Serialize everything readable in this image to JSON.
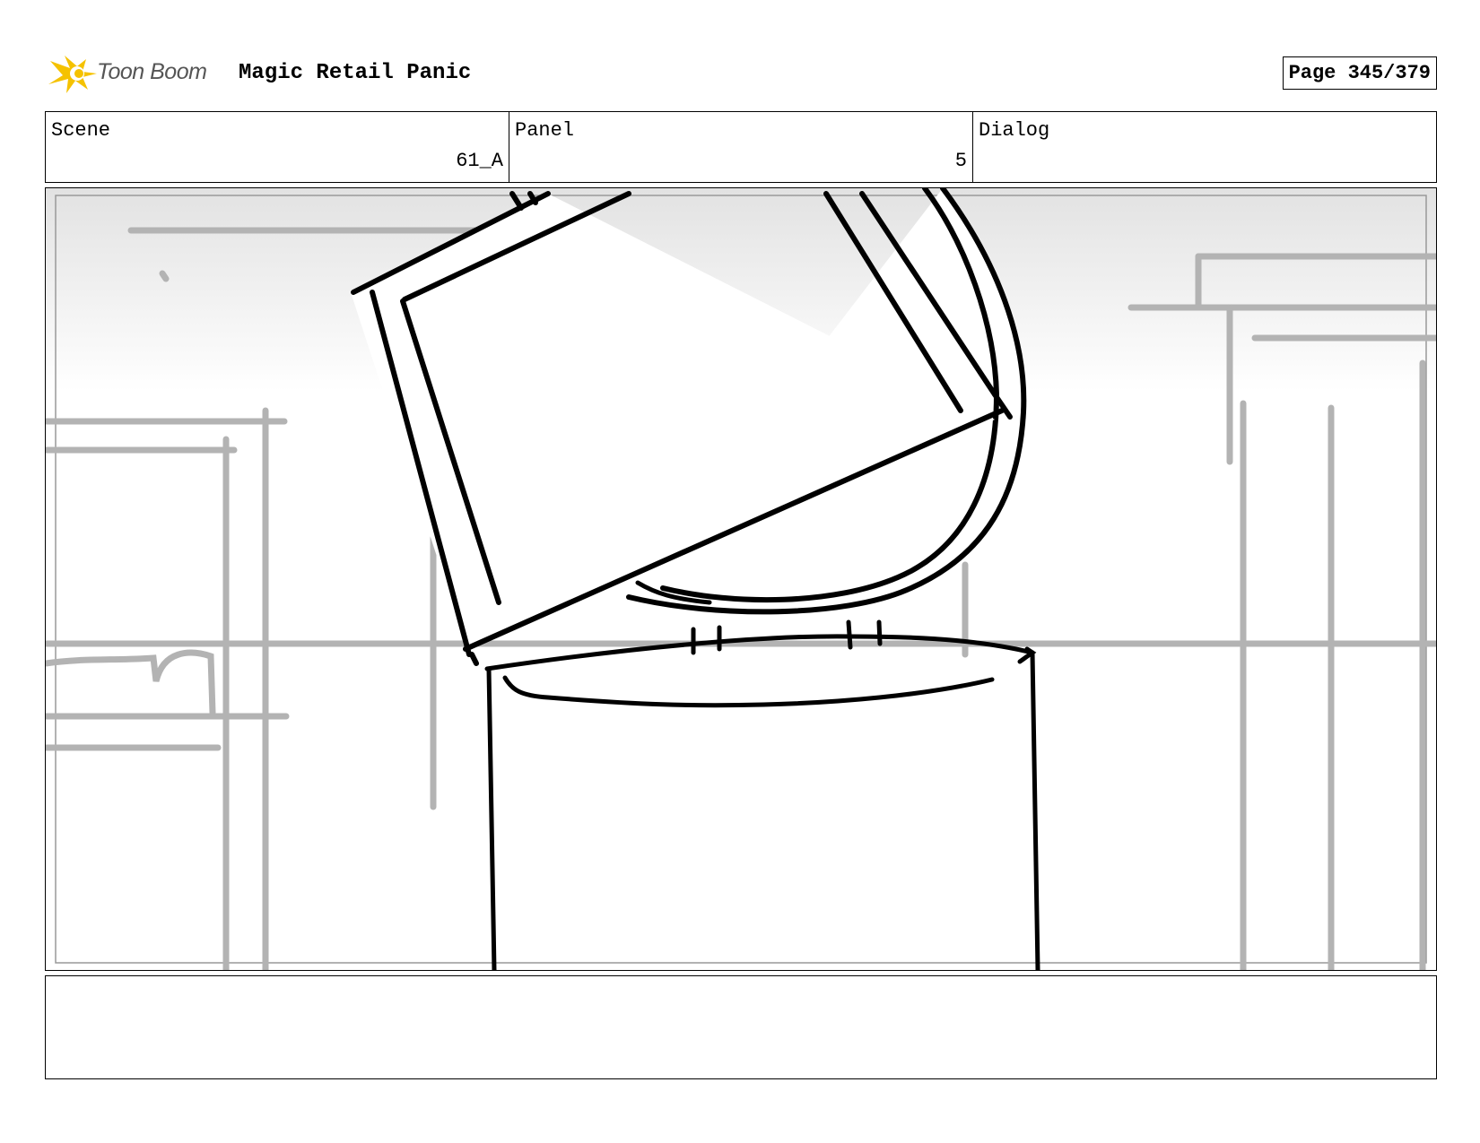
{
  "header": {
    "logo_text": "Toon Boom",
    "project_title": "Magic Retail Panic",
    "page_label": "Page 345/379"
  },
  "info": {
    "scene_label": "Scene",
    "scene_value": "61_A",
    "panel_label": "Panel",
    "panel_value": "5",
    "dialog_label": "Dialog",
    "dialog_value": ""
  },
  "notes": {
    "text": ""
  },
  "colors": {
    "logo_accent": "#f5c200",
    "sketch_gray": "#b3b3b3",
    "ink": "#000000"
  },
  "icons": {
    "logo": "toon-boom-star-icon"
  }
}
